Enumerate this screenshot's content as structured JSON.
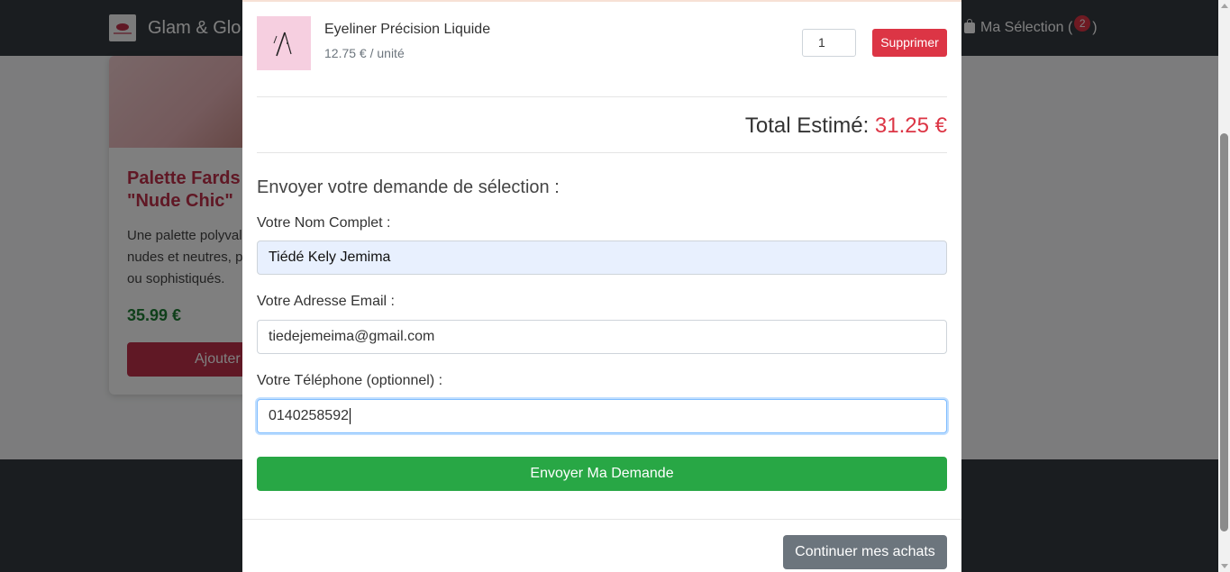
{
  "navbar": {
    "brand": "Glam & Glo",
    "cart_label": "Ma Sélection (",
    "cart_count": "2",
    "cart_close": ")"
  },
  "product_card": {
    "title": "Palette Fards\n\"Nude Chic\"",
    "description": "Une palette polyval\nnudes et neutres, p\nou sophistiqués.",
    "price": "35.99 €",
    "button": "Ajouter"
  },
  "modal": {
    "item": {
      "name": "Eyeliner Précision Liquide",
      "unit_price": "12.75 € / unité",
      "quantity": "1",
      "delete_label": "Supprimer"
    },
    "total": {
      "label": "Total Estimé:",
      "amount": "31.25 €"
    },
    "form": {
      "title": "Envoyer votre demande de sélection :",
      "name_label": "Votre Nom Complet :",
      "name_value": "Tiédé Kely Jemima",
      "email_label": "Votre Adresse Email :",
      "email_value": "tiedejemeima@gmail.com",
      "phone_label": "Votre Téléphone (optionnel) :",
      "phone_value": "0140258592",
      "submit_label": "Envoyer Ma Demande"
    },
    "continue_label": "Continuer mes achats"
  },
  "colors": {
    "accent_red": "#dc3545",
    "brand_pink": "#c0304a",
    "submit_green": "#28a745",
    "secondary_gray": "#6c757d",
    "navbar_dark": "#343a40"
  }
}
